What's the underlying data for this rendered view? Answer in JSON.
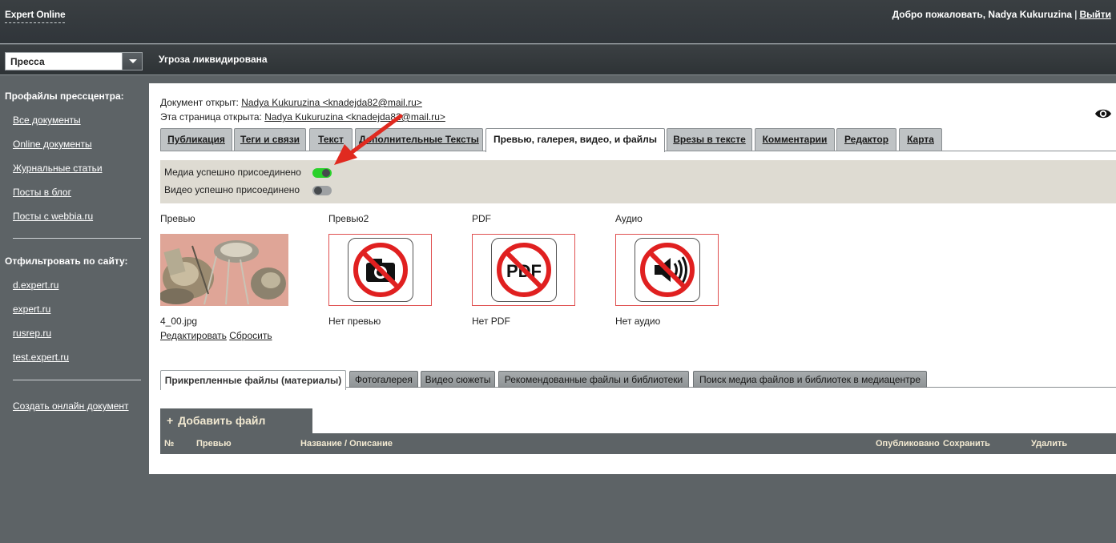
{
  "header": {
    "brand": "Expert Online",
    "welcome": "Добро пожаловать, Nadya Kukuruzina",
    "separator": "|",
    "logout": "Выйти"
  },
  "subbar": {
    "section_select": "Пресса",
    "document_title": "Угроза ликвидирована"
  },
  "sidebar": {
    "profiles_heading": "Профайлы прессцентра:",
    "profiles": [
      "Все документы",
      "Online документы",
      "Журнальные статьи",
      "Посты в блог",
      "Посты с webbia.ru"
    ],
    "filter_heading": "Отфильтровать по сайту:",
    "sites": [
      "d.expert.ru",
      "expert.ru",
      "rusrep.ru",
      "test.expert.ru"
    ],
    "create_online": "Создать онлайн документ"
  },
  "meta": {
    "opened_label": "Документ открыт:",
    "opened_by": "Nadya Kukuruzina <knadejda82@mail.ru>",
    "page_opened_label": "Эта страница открыта:",
    "page_opened_by": "Nadya Kukuruzina <knadejda82@mail.ru>"
  },
  "tabs": [
    {
      "label": "Публикация"
    },
    {
      "label": "Теги и связи"
    },
    {
      "label": "Текст"
    },
    {
      "label": "Дополнительные Тексты"
    },
    {
      "label": "Превью, галерея, видео, и файлы"
    },
    {
      "label": "Врезы в тексте"
    },
    {
      "label": "Комментарии"
    },
    {
      "label": "Редактор"
    },
    {
      "label": "Карта"
    }
  ],
  "active_tab": 4,
  "status": {
    "media_attached": "Медиа успешно присоединено",
    "media_toggle_on": true,
    "video_attached": "Видео успешно присоединено",
    "video_toggle_on": false
  },
  "media": {
    "preview_label": "Превью",
    "preview_file": "4_00.jpg",
    "edit": "Редактировать",
    "reset": "Сбросить",
    "preview2_label": "Превью2",
    "preview2_none": "Нет превью",
    "pdf_label": "PDF",
    "pdf_none": "Нет PDF",
    "pdf_icon_text": "PDF",
    "audio_label": "Аудио",
    "audio_none": "Нет аудио"
  },
  "file_tabs": [
    {
      "label": "Прикрепленные файлы (материалы)"
    },
    {
      "label": "Фотогалерея"
    },
    {
      "label": "Видео сюжеты"
    },
    {
      "label": "Рекомендованные файлы и библиотеки"
    },
    {
      "label": "Поиск медиа файлов и библиотек в медиацентре"
    }
  ],
  "files": {
    "add_file": "Добавить файл",
    "columns": [
      "№",
      "Превью",
      "Название / Описание",
      "Опубликовано",
      "Сохранить",
      "Удалить"
    ]
  },
  "colors": {
    "toggle_on": "#2ad12a",
    "annotation_arrow": "#e02a20",
    "no_sign": "#e02020"
  }
}
